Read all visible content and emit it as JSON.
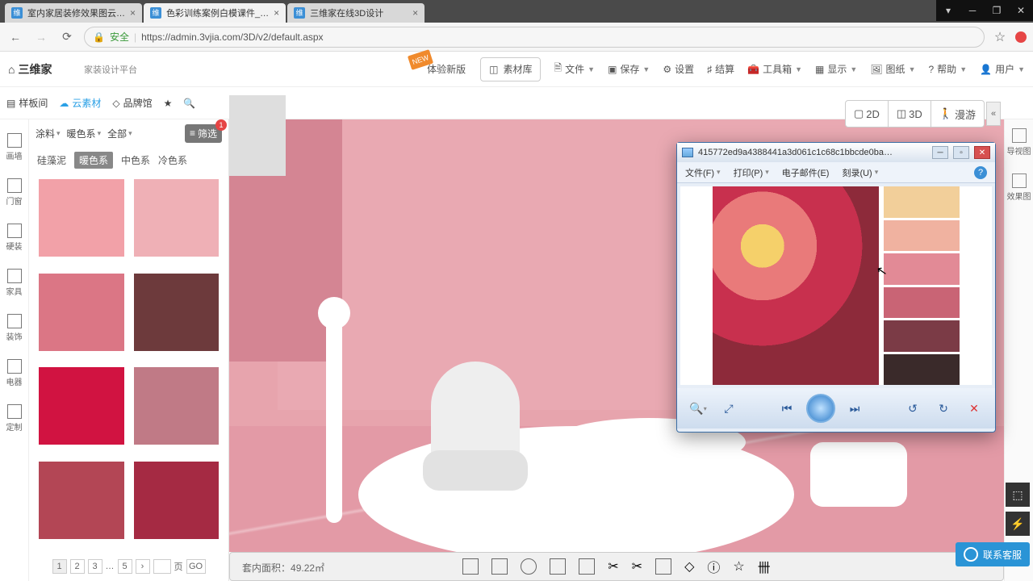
{
  "tabs": [
    {
      "title": "室内家居装修效果图云…"
    },
    {
      "title": "色彩训练案例白模课件_…"
    },
    {
      "title": "三维家在线3D设计"
    }
  ],
  "url": {
    "secure": "安全",
    "text": "https://admin.3vjia.com/3D/v2/default.aspx"
  },
  "logo": {
    "brand": "三维家",
    "sub": "家装设计平台"
  },
  "pills": {
    "new_badge": "NEW",
    "try": "体验新版",
    "lib": "素材库"
  },
  "menu": {
    "file": "文件",
    "save": "保存",
    "settings": "设置",
    "calc": "结算",
    "tools": "工具箱",
    "display": "显示",
    "drawings": "图纸",
    "help": "帮助",
    "user": "用户"
  },
  "secbar": {
    "sample": "样板间",
    "cloud": "云素材",
    "brand": "品牌馆"
  },
  "rail": {
    "draw": "画墙",
    "door": "门窗",
    "hard": "硬装",
    "furn": "家具",
    "deco": "装饰",
    "elec": "电器",
    "custom": "定制"
  },
  "filters": {
    "paint": "涂料",
    "warm": "暖色系",
    "all": "全部",
    "sift": "筛选",
    "sift_count": "1"
  },
  "cats": {
    "gui": "硅藻泥",
    "warm": "暖色系",
    "mid": "中色系",
    "cold": "冷色系"
  },
  "swatches": [
    "#f2a1a8",
    "#efb0b6",
    "#db7685",
    "#6d3a3c",
    "#d11341",
    "#c07a86",
    "#b34655",
    "#a52a43"
  ],
  "pager": {
    "p1": "1",
    "p2": "2",
    "p3": "3",
    "dots": "…",
    "p5": "5",
    "pgword": "页",
    "go": "GO"
  },
  "area": {
    "label": "套内面积：",
    "value": "49.22㎡"
  },
  "view": {
    "d2": "2D",
    "d3": "3D",
    "roam": "漫游"
  },
  "rightrail": {
    "nav": "导视图",
    "render": "效果图"
  },
  "support": "联系客服",
  "pv": {
    "title": "415772ed9a4388441a3d061c1c68c1bbcde0ba…",
    "menu": {
      "file": "文件(F)",
      "print": "打印(P)",
      "email": "电子邮件(E)",
      "burn": "刻录(U)"
    },
    "palette": [
      "#f2cf9a",
      "#f0b2a0",
      "#e28a96",
      "#c96475",
      "#7b3b46",
      "#3a2a2a"
    ]
  }
}
